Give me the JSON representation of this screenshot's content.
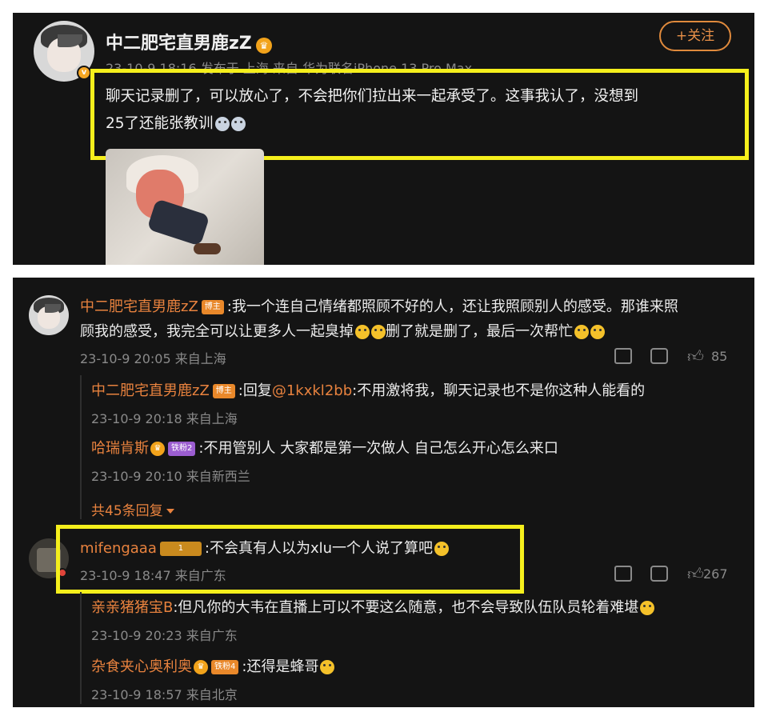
{
  "post": {
    "author": "中二肥宅直男鹿zZ",
    "meta": "23-10-9 18:16 发布于 上海 来自 华为联名iPhone 13 Pro Max",
    "follow_label": "+关注",
    "text_line1": "聊天记录删了，可以放心了，不会把你们拉出来一起承受了。这事我认了，没想到",
    "text_line2": "25了还能张教训"
  },
  "comments": [
    {
      "author": "中二肥宅直男鹿zZ",
      "tag": "博主",
      "text_line1": ":我一个连自己情绪都照顾不好的人，还让我照顾别人的感受。那谁来照",
      "text_line2a": "顾我的感受，我完全可以让更多人一起臭掉",
      "text_line2b": "删了就是删了，最后一次帮忙",
      "meta": "23-10-9 20:05 来自上海",
      "likes": "85",
      "replies": [
        {
          "author": "中二肥宅直男鹿zZ",
          "tag": "博主",
          "prefix": ":回复",
          "mention": "@1kxkl2bb",
          "text": ":不用激将我，聊天记录也不是你这种人能看的",
          "meta": "23-10-9 20:18 来自上海"
        },
        {
          "author": "哈瑞肯斯",
          "tag": "铁粉2",
          "text": ":不用管别人 大家都是第一次做人 自己怎么开心怎么来口",
          "meta": "23-10-9 20:10 来自新西兰"
        }
      ],
      "more_replies": "共45条回复"
    },
    {
      "author": "mifengaaa",
      "tag": "1",
      "text": ":不会真有人以为xlu一个人说了算吧",
      "meta": "23-10-9 18:47 来自广东",
      "likes": "267",
      "replies": [
        {
          "author": "亲亲猪猪宝B",
          "text": ":但凡你的大韦在直播上可以不要这么随意，也不会导致队伍队员轮着难堪",
          "meta": "23-10-9 20:23 来自广东"
        },
        {
          "author": "杂食夹心奥利奥",
          "tag": "铁粉4",
          "text": ":还得是蜂哥",
          "meta": "23-10-9 18:57 来自北京"
        }
      ]
    }
  ],
  "colors": {
    "background": "#141414",
    "accent": "#e8823e",
    "highlight": "#f5ef1c"
  }
}
